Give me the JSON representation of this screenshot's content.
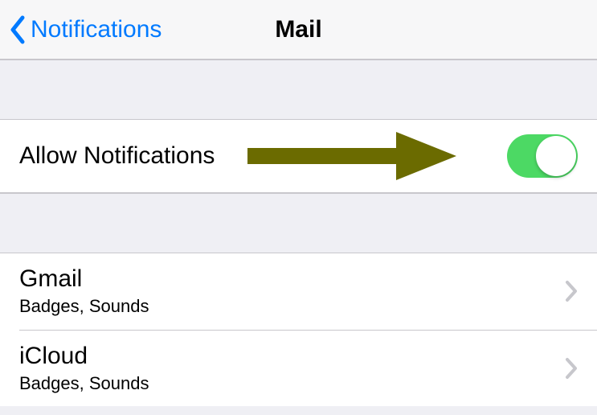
{
  "navbar": {
    "back_label": "Notifications",
    "title": "Mail"
  },
  "allow_row": {
    "label": "Allow Notifications",
    "toggle_on": true
  },
  "accounts": [
    {
      "title": "Gmail",
      "subtitle": "Badges, Sounds"
    },
    {
      "title": "iCloud",
      "subtitle": "Badges, Sounds"
    }
  ],
  "colors": {
    "ios_blue": "#007aff",
    "toggle_green": "#4cd964",
    "annotation_arrow": "#6b6b00"
  }
}
